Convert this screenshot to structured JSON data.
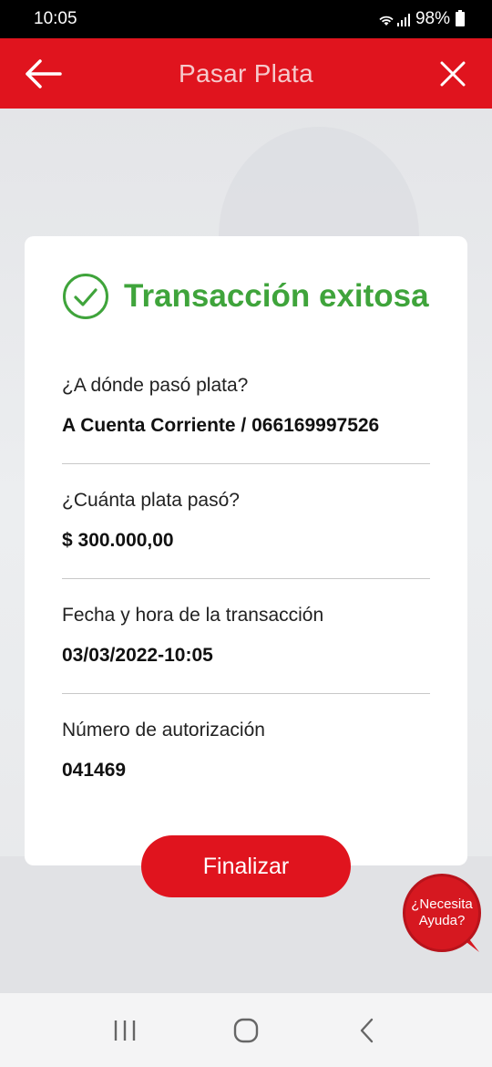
{
  "status_bar": {
    "time": "10:05",
    "battery": "98%"
  },
  "header": {
    "title": "Pasar Plata",
    "back_icon": "arrow-left-icon",
    "close_icon": "close-icon"
  },
  "card": {
    "success_title": "Transacción exitosa",
    "fields": [
      {
        "label": "¿A dónde pasó plata?",
        "value": "A Cuenta Corriente / 066169997526"
      },
      {
        "label": "¿Cuánta plata pasó?",
        "value": "$ 300.000,00"
      },
      {
        "label": "Fecha y hora de la transacción",
        "value": "03/03/2022-10:05"
      },
      {
        "label": "Número de autorización",
        "value": "041469"
      }
    ]
  },
  "finish_button": {
    "label": "Finalizar"
  },
  "help": {
    "line1": "¿Necesita",
    "line2": "Ayuda?"
  },
  "colors": {
    "brand_red": "#e0141e",
    "success_green": "#3fa43b"
  }
}
